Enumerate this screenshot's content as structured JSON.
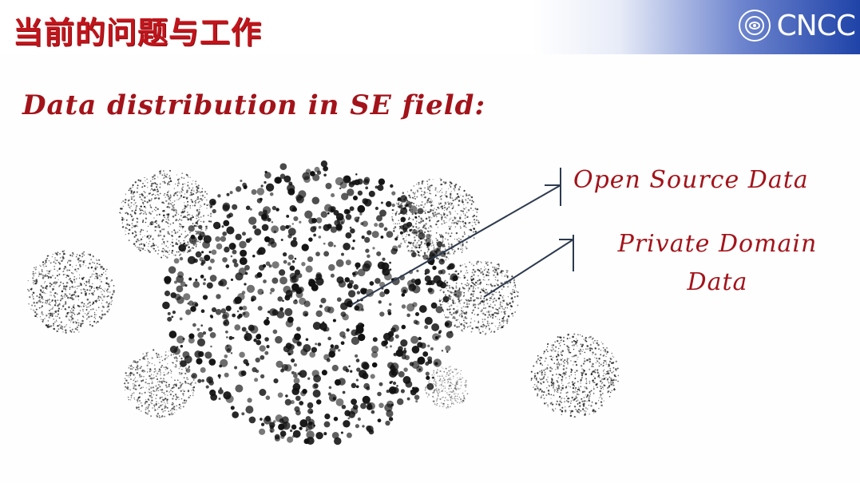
{
  "slide": {
    "title": "当前的问题与工作",
    "logo_text": "CNCC",
    "subtitle": "Data distribution in SE field:",
    "labels": {
      "open_source": "Open Source Data",
      "private_domain_line1": "Private Domain",
      "private_domain_line2": "Data"
    }
  },
  "colors": {
    "title_red": "#c1151b",
    "label_red": "#a3131a",
    "header_blue": "#1f43a8",
    "dot_black": "#111111",
    "leader_line": "#2d3a4e"
  }
}
